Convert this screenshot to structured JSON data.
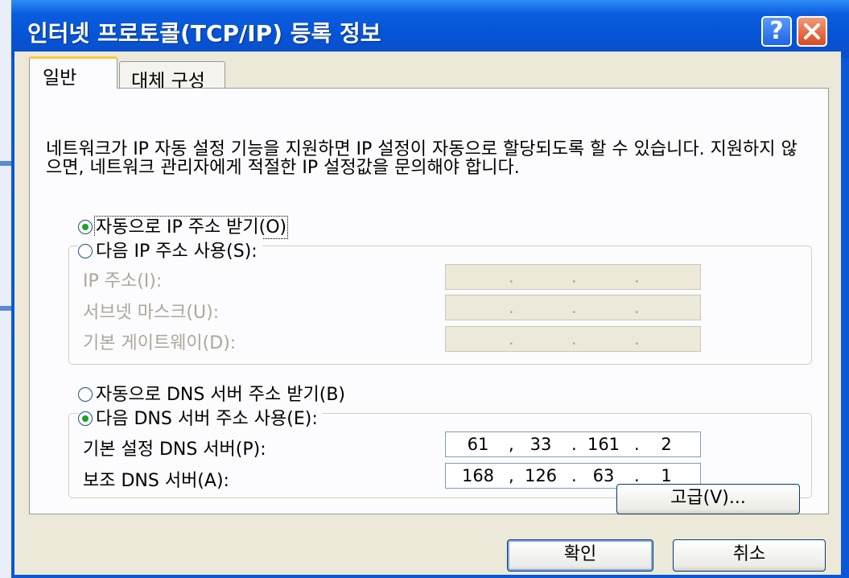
{
  "window": {
    "title": "인터넷 프로토콜(TCP/IP) 등록 정보",
    "help_label": "?"
  },
  "tabs": [
    {
      "label": "일반",
      "selected": true
    },
    {
      "label": "대체 구성",
      "selected": false
    }
  ],
  "description": "네트워크가 IP 자동 설정 기능을 지원하면 IP 설정이 자동으로 할당되도록 할 수 있습니다. 지원하지 않으면, 네트워크 관리자에게 적절한 IP 설정값을 문의해야 합니다.",
  "ip": {
    "auto_label": "자동으로 IP 주소 받기(O)",
    "auto_selected": true,
    "manual_label": "다음 IP 주소 사용(S):",
    "manual_selected": false,
    "fields": [
      {
        "label": "IP 주소(I):",
        "value": [
          "",
          "",
          "",
          ""
        ]
      },
      {
        "label": "서브넷 마스크(U):",
        "value": [
          "",
          "",
          "",
          ""
        ]
      },
      {
        "label": "기본 게이트웨이(D):",
        "value": [
          "",
          "",
          "",
          ""
        ]
      }
    ]
  },
  "dns": {
    "auto_label": "자동으로 DNS 서버 주소 받기(B)",
    "auto_selected": false,
    "manual_label": "다음 DNS 서버 주소 사용(E):",
    "manual_selected": true,
    "preferred_label": "기본 설정 DNS 서버(P):",
    "preferred": [
      "61",
      "33",
      "161",
      "2"
    ],
    "alternate_label": "보조 DNS 서버(A):",
    "alternate": [
      "168",
      "126",
      "63",
      "1"
    ]
  },
  "buttons": {
    "advanced": "고급(V)...",
    "ok": "확인",
    "cancel": "취소"
  },
  "colors": {
    "titlebar": "#0a57d8",
    "dialog_face": "#ece9d8",
    "panel": "#fcfcfe",
    "disabled_text": "#aca899",
    "radio_dot": "#21a121"
  }
}
